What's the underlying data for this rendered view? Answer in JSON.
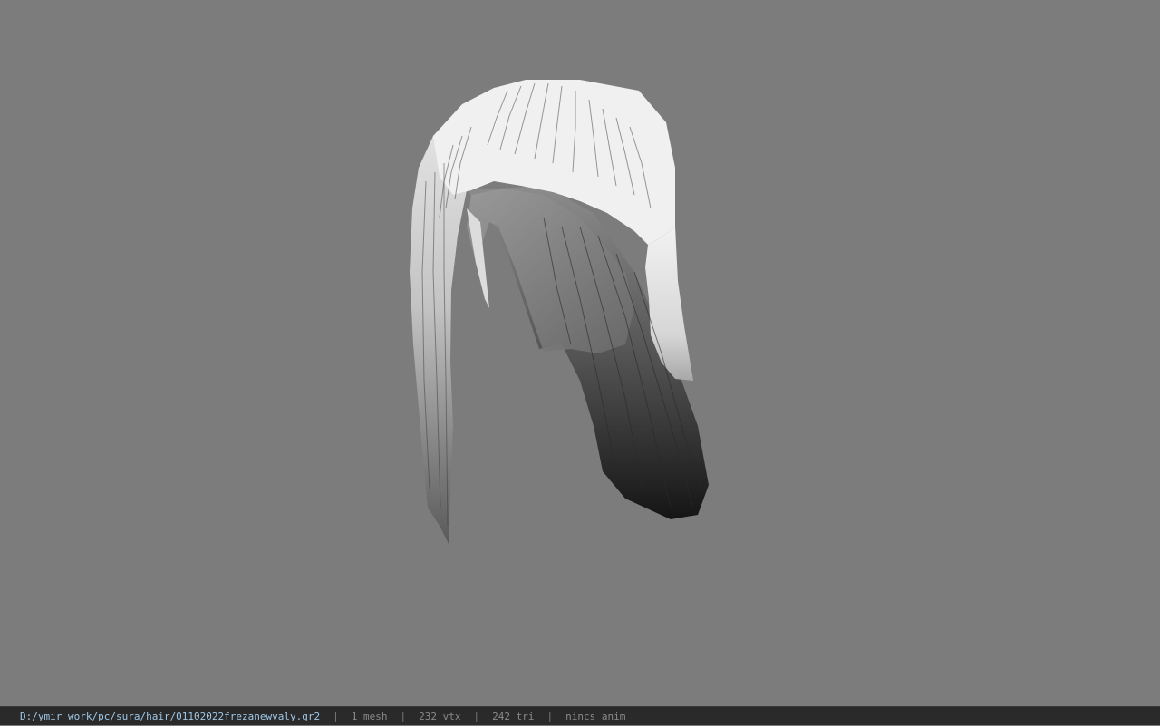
{
  "viewport": {
    "background_color": "#7c7c7c",
    "model_icon": "hair-mesh-icon"
  },
  "status": {
    "path": "D:/ymir work/pc/sura/hair/01102022frezanewvaly.gr2",
    "separator": "|",
    "mesh": "1 mesh",
    "vtx": "232 vtx",
    "tri": "242 tri",
    "anim": "nincs anim",
    "path_color": "#9fc8e8"
  }
}
